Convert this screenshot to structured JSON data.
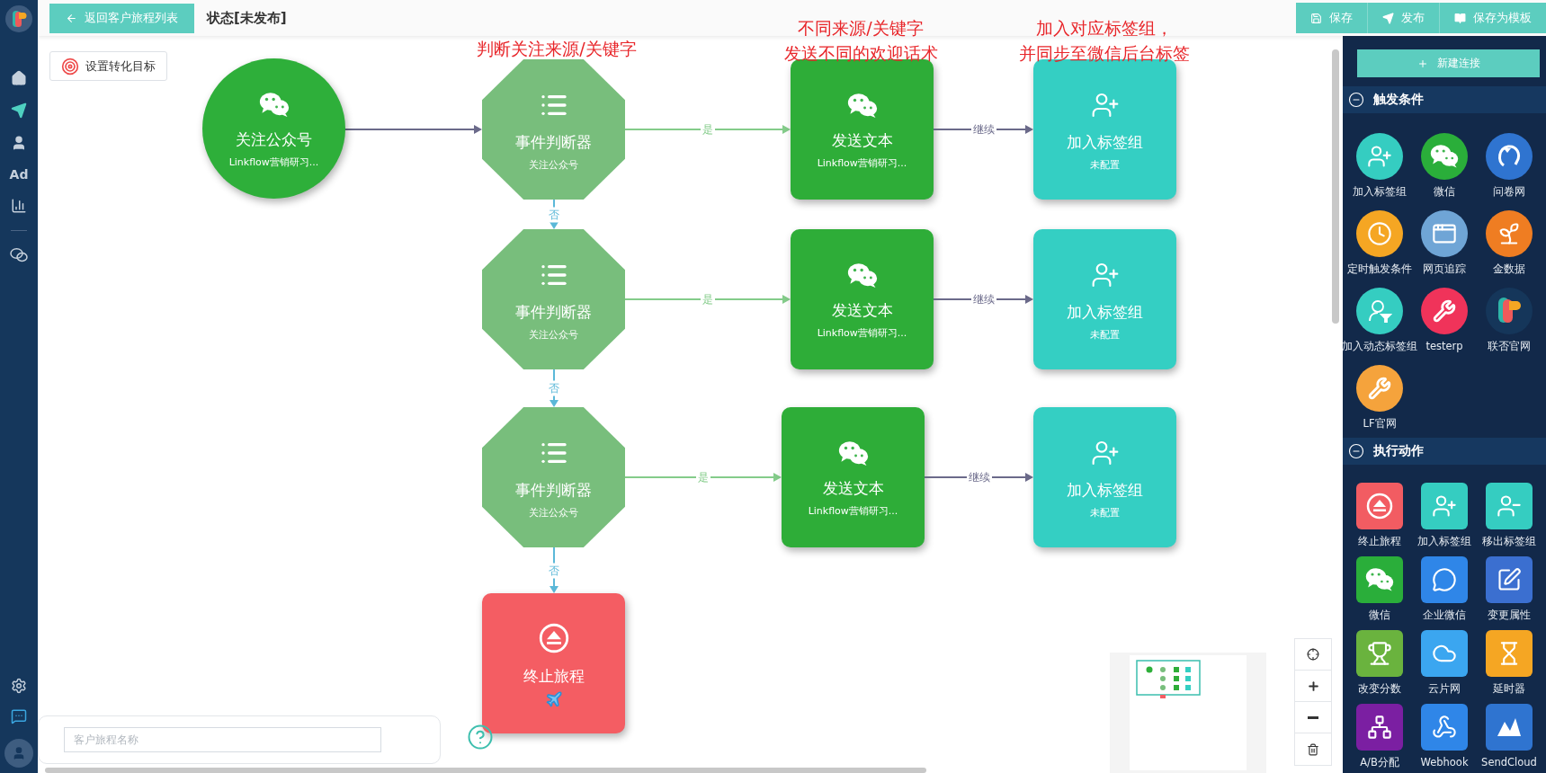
{
  "sidebar": {
    "items": [
      {
        "kind": "home",
        "selected": false
      },
      {
        "kind": "send",
        "selected": true
      },
      {
        "kind": "user",
        "selected": false
      },
      {
        "kind": "text",
        "label": "Ad",
        "selected": false
      },
      {
        "kind": "chart",
        "selected": false
      },
      {
        "kind": "wechat",
        "selected": false
      }
    ],
    "bottom_items": [
      {
        "kind": "settings"
      },
      {
        "kind": "chat"
      },
      {
        "kind": "avatar"
      }
    ]
  },
  "toolbar": {
    "back_button": "返回客户旅程列表",
    "status": "状态[未发布]",
    "actions": [
      {
        "kind": "save",
        "label": "保存"
      },
      {
        "kind": "publish",
        "label": "发布"
      },
      {
        "kind": "template",
        "label": "保存为模板"
      }
    ]
  },
  "goal_button": "设置转化目标",
  "annotations": [
    {
      "lines": [
        "判断关注来源/关键字"
      ]
    },
    {
      "lines": [
        "不同来源/关键字",
        "发送不同的欢迎话术"
      ]
    },
    {
      "lines": [
        "加入对应标签组，",
        "并同步至微信后台标签"
      ]
    }
  ],
  "flow": {
    "start": {
      "kind": "trigger",
      "title": "关注公众号",
      "subtitle": "Linkflow营销研习..."
    },
    "branches": [
      {
        "judge": {
          "kind": "judge",
          "title": "事件判断器",
          "subtitle": "关注公众号"
        },
        "yes_label": "是",
        "action": {
          "kind": "send",
          "title": "发送文本",
          "subtitle": "Linkflow营销研习..."
        },
        "continue_label": "继续",
        "tag": {
          "kind": "tag",
          "title": "加入标签组",
          "subtitle": "未配置"
        },
        "no_label": "否"
      },
      {
        "judge": {
          "kind": "judge",
          "title": "事件判断器",
          "subtitle": "关注公众号"
        },
        "yes_label": "是",
        "action": {
          "kind": "send",
          "title": "发送文本",
          "subtitle": "Linkflow营销研习..."
        },
        "continue_label": "继续",
        "tag": {
          "kind": "tag",
          "title": "加入标签组",
          "subtitle": "未配置"
        },
        "no_label": "否"
      },
      {
        "judge": {
          "kind": "judge",
          "title": "事件判断器",
          "subtitle": "关注公众号"
        },
        "yes_label": "是",
        "action": {
          "kind": "send",
          "title": "发送文本",
          "subtitle": "Linkflow营销研习..."
        },
        "continue_label": "继续",
        "tag": {
          "kind": "tag",
          "title": "加入标签组",
          "subtitle": "未配置"
        },
        "no_label": "否"
      }
    ],
    "end": {
      "kind": "end",
      "title": "终止旅程"
    }
  },
  "name_field": {
    "placeholder": "客户旅程名称"
  },
  "palette": {
    "new_button": "新建连接",
    "sections": [
      {
        "title": "触发条件",
        "kind": "trigger",
        "expanded": true,
        "items": [
          {
            "kind": "user-plus",
            "label": "加入标签组",
            "color": "#35cdc1"
          },
          {
            "kind": "wechat",
            "label": "微信",
            "color": "#2aae3a"
          },
          {
            "kind": "survey",
            "label": "问卷网",
            "color": "#2f74d0"
          },
          {
            "kind": "clock",
            "label": "定时触发条件",
            "color": "#f5a623"
          },
          {
            "kind": "window",
            "label": "网页追踪",
            "color": "#6fa5d6"
          },
          {
            "kind": "sprout",
            "label": "金数据",
            "color": "#ef7d22"
          },
          {
            "kind": "user-filter",
            "label": "加入动态标签组",
            "color": "#35cdc1"
          },
          {
            "kind": "wrench",
            "label": "testerp",
            "color": "#f0335a"
          },
          {
            "kind": "logo",
            "label": "联否官网",
            "color": "#15365a"
          },
          {
            "kind": "wrench",
            "label": "LF官网",
            "color": "#f5a33c"
          }
        ]
      },
      {
        "title": "执行动作",
        "kind": "action",
        "expanded": true,
        "items": [
          {
            "kind": "eject",
            "label": "终止旅程",
            "color": "#f25c62"
          },
          {
            "kind": "user-plus",
            "label": "加入标签组",
            "color": "#35cdc1"
          },
          {
            "kind": "user-minus",
            "label": "移出标签组",
            "color": "#35cdc1"
          },
          {
            "kind": "wechat",
            "label": "微信",
            "color": "#2aae3a"
          },
          {
            "kind": "chat",
            "label": "企业微信",
            "color": "#2f86e8"
          },
          {
            "kind": "edit",
            "label": "变更属性",
            "color": "#3b6fd0"
          },
          {
            "kind": "trophy",
            "label": "改变分数",
            "color": "#6ab33e"
          },
          {
            "kind": "cloud",
            "label": "云片网",
            "color": "#3ba6f0"
          },
          {
            "kind": "hourglass",
            "label": "延时器",
            "color": "#f5a623"
          },
          {
            "kind": "split",
            "label": "A/B分配",
            "color": "#7b1fa2"
          },
          {
            "kind": "webhook",
            "label": "Webhook",
            "color": "#2f86e8"
          },
          {
            "kind": "sendcloud",
            "label": "SendCloud",
            "color": "#2f74d0"
          }
        ]
      }
    ]
  }
}
